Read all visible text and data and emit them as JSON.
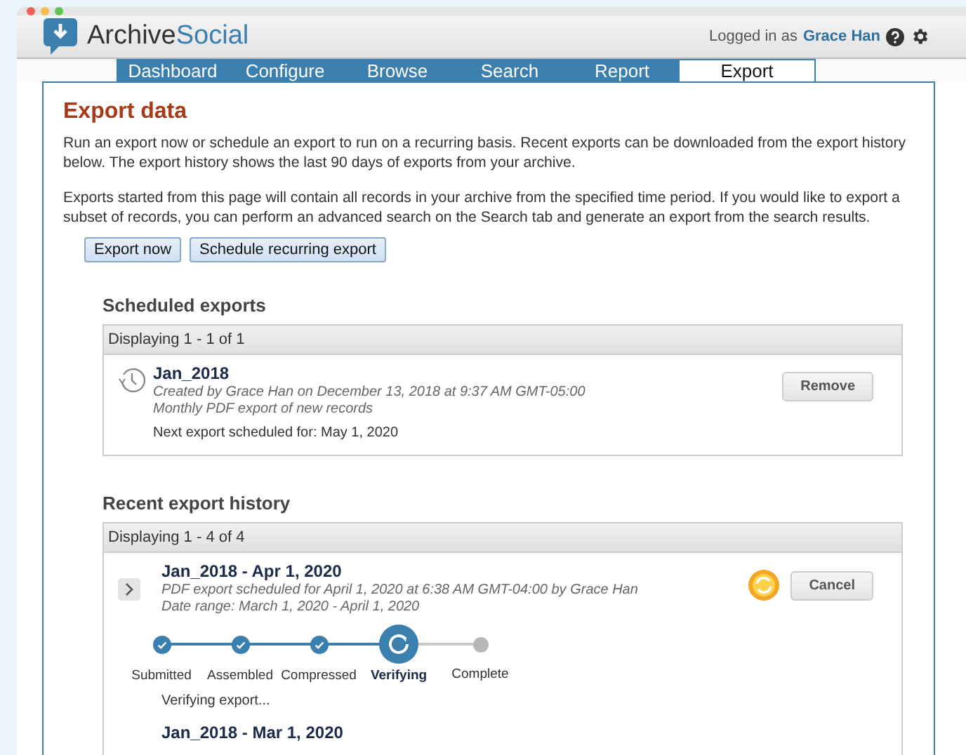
{
  "header": {
    "logo_left": "Archive",
    "logo_right": "Social",
    "user_prefix": "Logged in as",
    "user_name": "Grace Han"
  },
  "tabs": [
    {
      "label": "Dashboard",
      "selected": false
    },
    {
      "label": "Configure",
      "selected": false
    },
    {
      "label": "Browse",
      "selected": false
    },
    {
      "label": "Search",
      "selected": false
    },
    {
      "label": "Report",
      "selected": false
    },
    {
      "label": "Export",
      "selected": true
    }
  ],
  "page": {
    "title": "Export data",
    "intro": [
      "Run an export now or schedule an export to run on a recurring basis. Recent exports can be downloaded from the export history below. The export history shows the last 90 days of exports from your archive.",
      "Exports started from this page will contain all records in your archive from the specified time period. If you would like to export a subset of records, you can perform an advanced search on the Search tab and generate an export from the search results."
    ],
    "buttons": [
      "Export now",
      "Schedule recurring export"
    ]
  },
  "scheduled": {
    "title": "Scheduled exports",
    "count": "Displaying 1 - 1 of 1",
    "items": [
      {
        "name": "Jan_2018",
        "created": "Created by Grace Han on December 13, 2018 at 9:37 AM GMT-05:00",
        "description": "Monthly PDF export of new records",
        "next": "Next export scheduled for: May 1, 2020",
        "action": "Remove"
      }
    ]
  },
  "history": {
    "title": "Recent export history",
    "count": "Displaying 1 - 4 of 4",
    "items": [
      {
        "name": "Jan_2018 - Apr 1, 2020",
        "detail": "PDF export scheduled for April 1, 2020 at 6:38 AM GMT-04:00 by Grace Han",
        "range": "Date range: March 1, 2020 - April 1, 2020",
        "action": "Cancel",
        "in_progress": true,
        "status": "Verifying export...",
        "steps": [
          {
            "label": "Submitted",
            "completed": true,
            "current": false
          },
          {
            "label": "Assembled",
            "completed": true,
            "current": false
          },
          {
            "label": "Compressed",
            "completed": true,
            "current": false
          },
          {
            "label": "Verifying",
            "completed": false,
            "current": true
          },
          {
            "label": "Complete",
            "completed": false,
            "current": false
          }
        ]
      },
      {
        "name": "Jan_2018 - Mar 1, 2020"
      }
    ]
  }
}
